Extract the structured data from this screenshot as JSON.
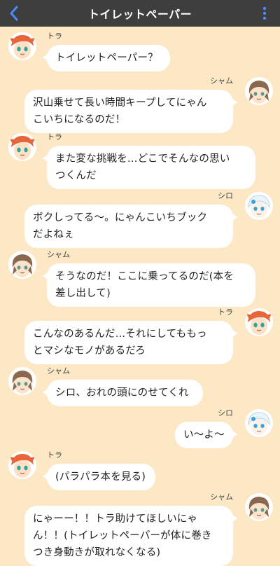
{
  "header": {
    "title": "トイレットペーパー",
    "back_icon": "chevron-left-icon",
    "more_icon": "more-vertical-icon",
    "accent_color": "#4a8cff"
  },
  "characters": {
    "tora": {
      "name": "トラ",
      "avatar_icon": "tora-avatar",
      "hair_color": "#e8643a"
    },
    "sham": {
      "name": "シャム",
      "avatar_icon": "sham-avatar",
      "hair_color": "#8a6850"
    },
    "shiro": {
      "name": "シロ",
      "avatar_icon": "shiro-avatar",
      "hair_color": "#eaf4fb"
    }
  },
  "messages": [
    {
      "side": "left",
      "speaker": "トラ",
      "text": "トイレットペーパー？"
    },
    {
      "side": "right",
      "speaker": "シャム",
      "text": "沢山乗せて長い時間キープしてにゃん\nこいちになるのだ！"
    },
    {
      "side": "left",
      "speaker": "トラ",
      "text": "また変な挑戦を…どこでそんなの思い\nつくんだ"
    },
    {
      "side": "right",
      "speaker": "シロ",
      "text": "ボクしってる〜。にゃんこいちブック\nだよねぇ"
    },
    {
      "side": "left",
      "speaker": "シャム",
      "text": "そうなのだ！ここに乗ってるのだ(本を\n差し出して)"
    },
    {
      "side": "right",
      "speaker": "トラ",
      "text": "こんなのあるんだ…それにしてももっ\nとマシなモノがあるだろ"
    },
    {
      "side": "left",
      "speaker": "シャム",
      "text": "シロ、おれの頭にのせてくれ"
    },
    {
      "side": "right",
      "speaker": "シロ",
      "text": "い〜よ〜"
    },
    {
      "side": "left",
      "speaker": "トラ",
      "text": "(パラパラ本を見る)"
    },
    {
      "side": "right",
      "speaker": "シャム",
      "text": "にゃーー！！トラ助けてほしいにゃ\nん！！(トイレットペーパーが体に巻き\nつき身動きが取れなくなる)"
    }
  ]
}
